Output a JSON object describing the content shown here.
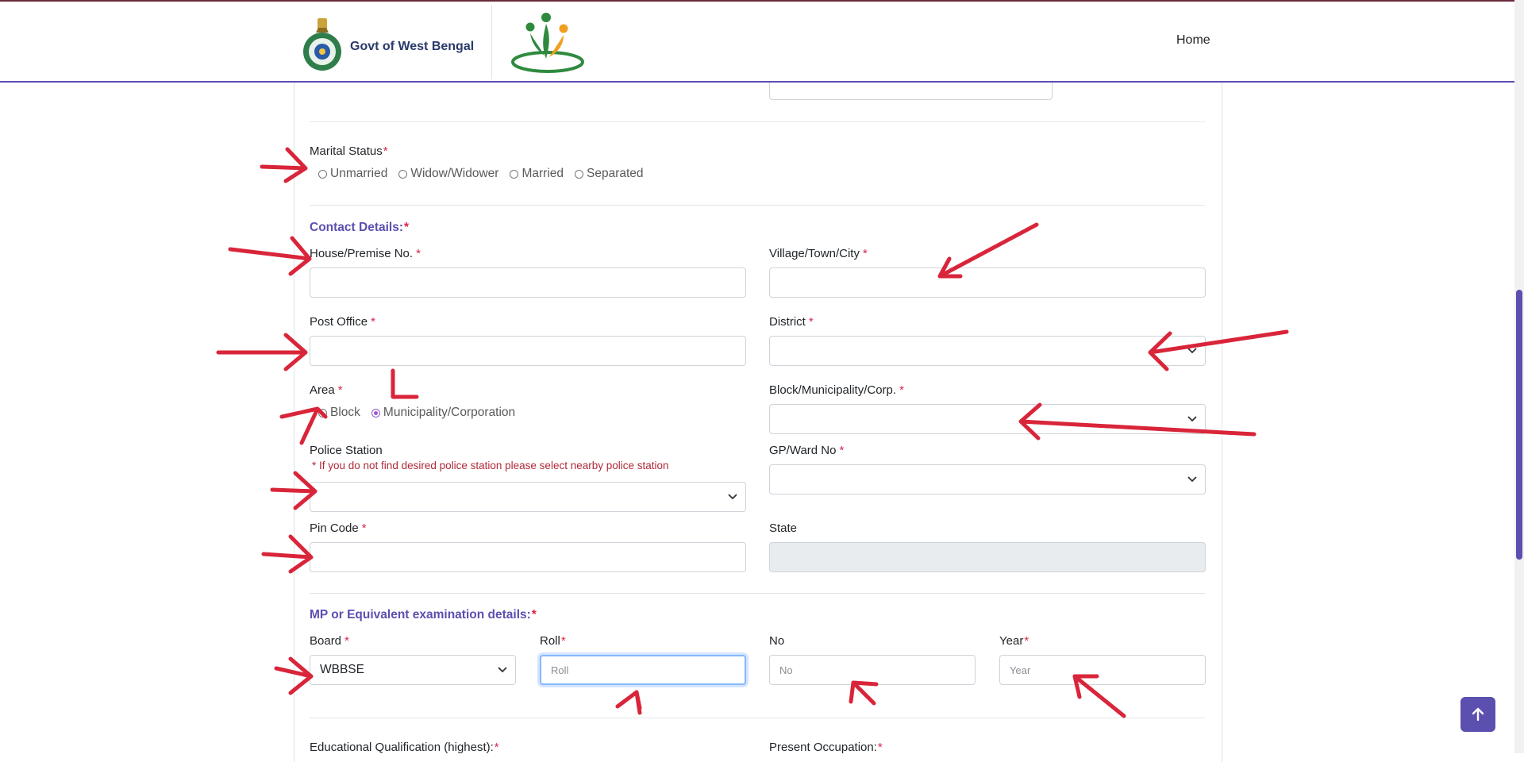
{
  "header": {
    "brand": "Govt of West Bengal",
    "nav_home": "Home"
  },
  "marital": {
    "label": "Marital Status",
    "options": [
      "Unmarried",
      "Widow/Widower",
      "Married",
      "Separated"
    ]
  },
  "contact": {
    "section": "Contact Details:",
    "house_label": "House/Premise No.",
    "village_label": "Village/Town/City",
    "post_office_label": "Post Office",
    "district_label": "District",
    "area_label": "Area",
    "area_options": [
      "Block",
      "Municipality/Corporation"
    ],
    "area_selected": "Municipality/Corporation",
    "block_label": "Block/Municipality/Corp.",
    "police_label": "Police Station",
    "police_note": "* If you do not find desired police station please select nearby police station",
    "gp_label": "GP/Ward No",
    "pin_label": "Pin Code",
    "state_label": "State"
  },
  "exam": {
    "section": "MP or Equivalent examination details:",
    "board_label": "Board",
    "board_value": "WBBSE",
    "roll_label": "Roll",
    "roll_placeholder": "Roll",
    "no_label": "No",
    "no_placeholder": "No",
    "year_label": "Year",
    "year_placeholder": "Year"
  },
  "next": {
    "edu_label": "Educational Qualification (highest):",
    "occupation_label": "Present Occupation:"
  },
  "required_mark": "*",
  "colors": {
    "accent": "#5b4fb0",
    "required": "#d9254a",
    "annotation_arrow": "#d9253a"
  },
  "icons": {
    "scroll_top": "arrow-up-icon",
    "select": "chevron-down-icon"
  }
}
